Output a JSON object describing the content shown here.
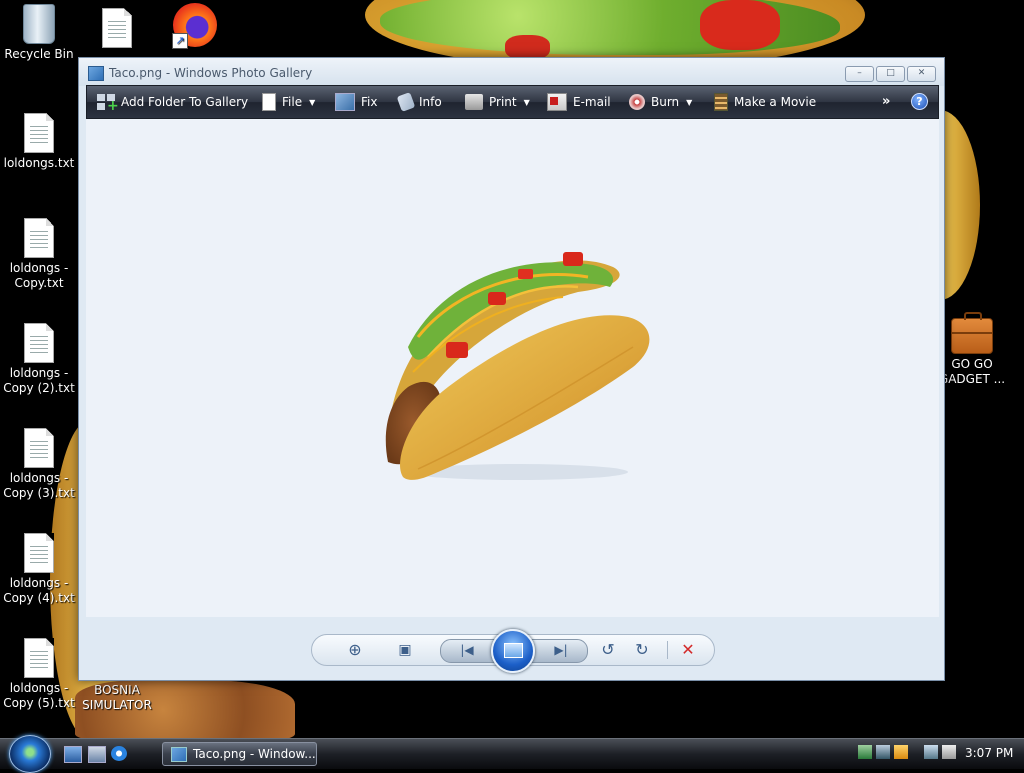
{
  "desktop": {
    "icons": [
      {
        "label": "Recycle Bin"
      },
      {
        "label": ""
      },
      {
        "label": ""
      },
      {
        "label": "loldongs.txt"
      },
      {
        "label": "loldongs - Copy.txt"
      },
      {
        "label": "loldongs - Copy (2).txt"
      },
      {
        "label": "loldongs - Copy (3).txt"
      },
      {
        "label": "loldongs - Copy (4).txt"
      },
      {
        "label": "loldongs - Copy (5).txt"
      },
      {
        "label": "BOSNIA SIMULATOR"
      },
      {
        "label": "GO GO GADGET ..."
      }
    ]
  },
  "window": {
    "title": "Taco.png - Windows Photo Gallery",
    "caption_buttons": {
      "minimize": "–",
      "maximize": "□",
      "close": "✕"
    },
    "toolbar": {
      "add_folder": "Add Folder To Gallery",
      "file": "File",
      "fix": "Fix",
      "info": "Info",
      "print": "Print",
      "email": "E-mail",
      "burn": "Burn",
      "make_movie": "Make a Movie",
      "more": "»",
      "help": "?"
    },
    "controls": {
      "zoom": "⊕",
      "fit": "▣",
      "previous": "|◀",
      "next": "▶|",
      "rotate_ccw": "↺",
      "rotate_cw": "↻",
      "delete": "✕"
    },
    "image_icon": "taco-image"
  },
  "taskbar": {
    "active_button": "Taco.png - Window...",
    "clock": "3:07 PM"
  },
  "colors": {
    "toolbar_bg": "#2f3542",
    "viewer_bg": "#edf2f9",
    "delete_red": "#d32a2a",
    "accent_blue": "#1c5fc8"
  }
}
